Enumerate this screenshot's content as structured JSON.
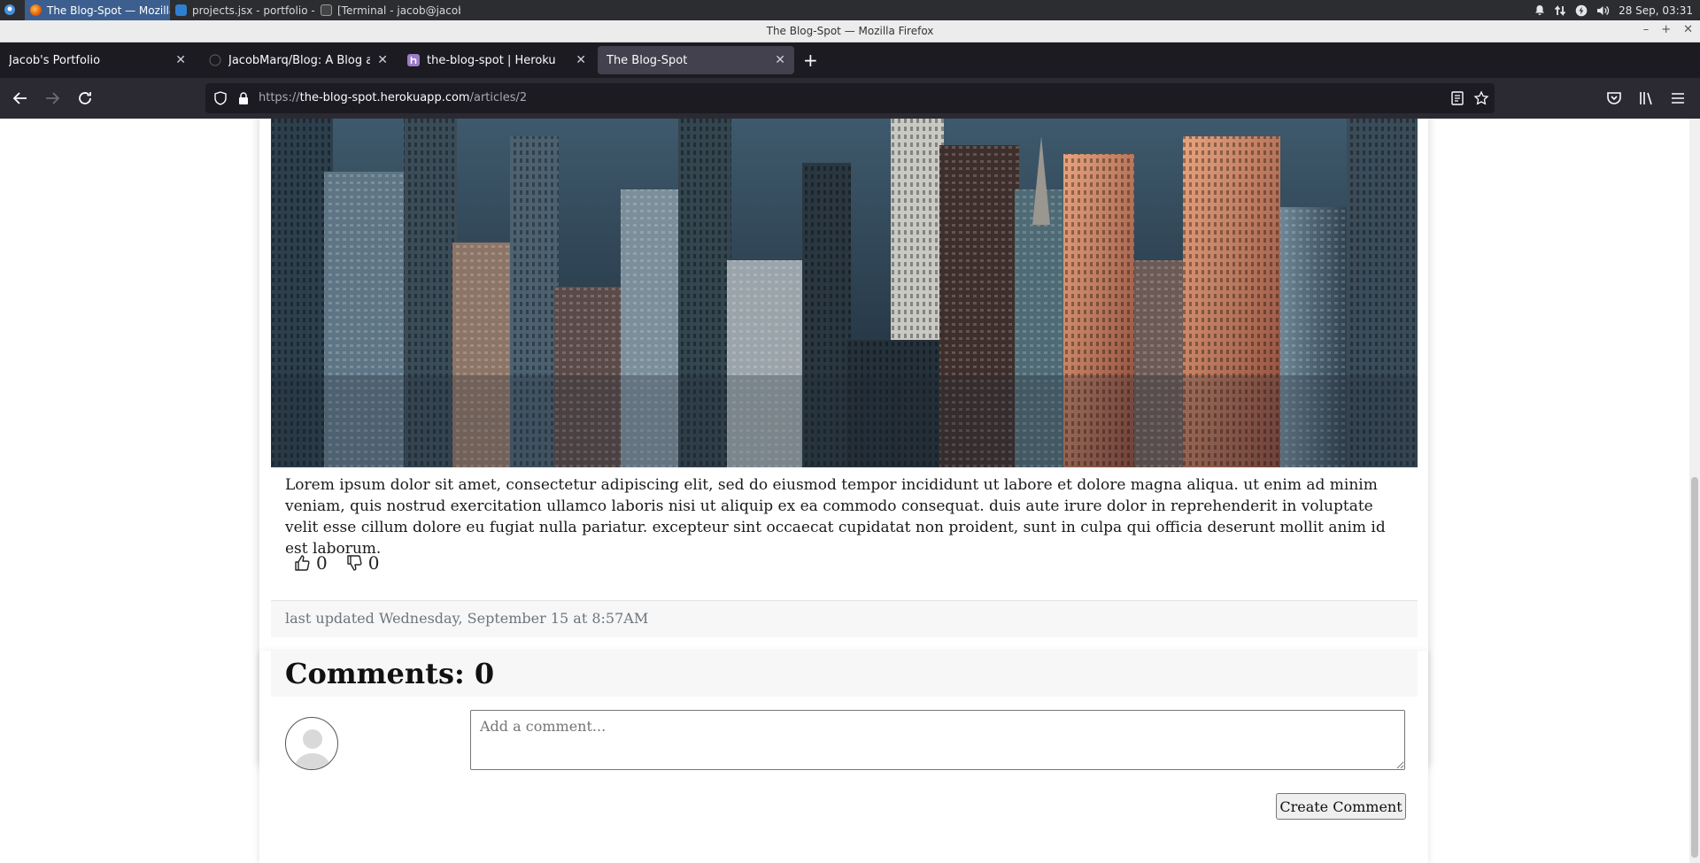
{
  "taskbar": {
    "tasks": [
      {
        "label": "The Blog-Spot — Mozilla Fire..."
      },
      {
        "label": "projects.jsx - portfolio - Visua..."
      },
      {
        "label": "[Terminal - jacob@jacob-Virt..."
      }
    ],
    "clock": "28 Sep, 03:31"
  },
  "window": {
    "title": "The Blog-Spot — Mozilla Firefox"
  },
  "tabs": [
    {
      "label": "Jacob's Portfolio"
    },
    {
      "label": "JacobMarq/Blog: A Blog app o"
    },
    {
      "label": "the-blog-spot | Heroku"
    },
    {
      "label": "The Blog-Spot"
    }
  ],
  "url": {
    "prefix": "https://",
    "host": "the-blog-spot.herokuapp.com",
    "path": "/articles/2"
  },
  "article": {
    "body": "Lorem ipsum dolor sit amet, consectetur adipiscing elit, sed do eiusmod tempor incididunt ut labore et dolore magna aliqua. ut enim ad minim veniam, quis nostrud exercitation ullamco laboris nisi ut aliquip ex ea commodo consequat. duis aute irure dolor in reprehenderit in voluptate velit esse cillum dolore eu fugiat nulla pariatur. excepteur sint occaecat cupidatat non proident, sunt in culpa qui officia deserunt mollit anim id est laborum.",
    "likes": "0",
    "dislikes": "0",
    "updated": "last updated Wednesday, September 15 at 8:57AM"
  },
  "comments": {
    "title": "Comments: 0",
    "placeholder": "Add a comment...",
    "submit_label": "Create Comment"
  },
  "colors": {
    "accent_tab": "#42414d",
    "taskbar": "#2b2d31",
    "footer_text": "#6c757d"
  }
}
